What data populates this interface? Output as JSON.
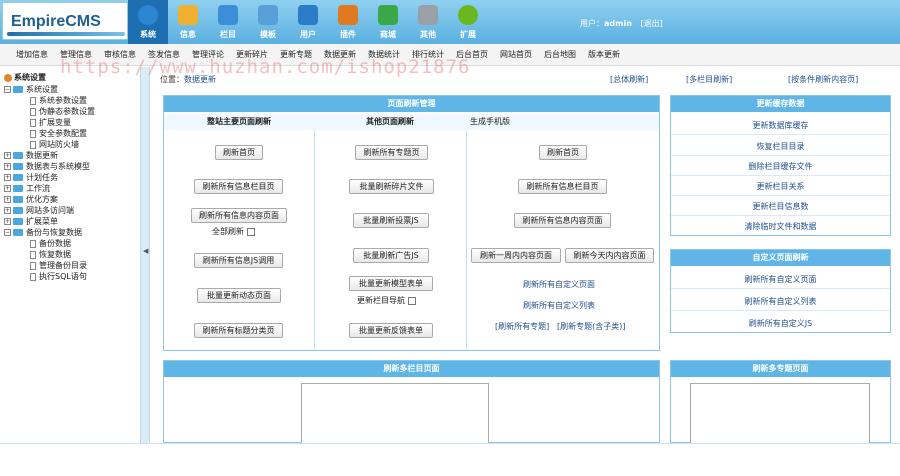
{
  "header": {
    "logo": "EmpireCMS",
    "user_prefix": "用户：",
    "username": "admin",
    "logout": "[退出]",
    "nav": [
      {
        "label": "系统",
        "icon": "globe-icon",
        "color": "#2d86d2"
      },
      {
        "label": "信息",
        "icon": "pencil-note-icon",
        "color": "#f0b030"
      },
      {
        "label": "栏目",
        "icon": "folder-icon",
        "color": "#3a8fd8"
      },
      {
        "label": "模板",
        "icon": "window-icon",
        "color": "#5aa0d8"
      },
      {
        "label": "用户",
        "icon": "user-icon",
        "color": "#2a7cc8"
      },
      {
        "label": "插件",
        "icon": "tools-icon",
        "color": "#e07a20"
      },
      {
        "label": "商城",
        "icon": "shop-icon",
        "color": "#38a848"
      },
      {
        "label": "其他",
        "icon": "gear-icon",
        "color": "#9aa0a8"
      },
      {
        "label": "扩展",
        "icon": "plus-circle-icon",
        "color": "#6ab820"
      }
    ]
  },
  "subnav": [
    "增加信息",
    "管理信息",
    "审核信息",
    "签发信息",
    "管理评论",
    "更新碎片",
    "更新专题",
    "数据更新",
    "数据统计",
    "排行统计",
    "后台首页",
    "网站首页",
    "后台地图",
    "版本更新"
  ],
  "watermark": "https://www.huzhan.com/ishop21876",
  "tree": {
    "title": "系统设置",
    "items": [
      {
        "label": "系统设置",
        "level": 0,
        "expanded": true
      },
      {
        "label": "系统参数设置",
        "level": 1
      },
      {
        "label": "伪静态参数设置",
        "level": 1
      },
      {
        "label": "扩展变量",
        "level": 1
      },
      {
        "label": "安全参数配置",
        "level": 1
      },
      {
        "label": "网站防火墙",
        "level": 1
      },
      {
        "label": "数据更新",
        "level": 0
      },
      {
        "label": "数据表与系统模型",
        "level": 0
      },
      {
        "label": "计划任务",
        "level": 0
      },
      {
        "label": "工作流",
        "level": 0
      },
      {
        "label": "优化方案",
        "level": 0
      },
      {
        "label": "网站多访问端",
        "level": 0
      },
      {
        "label": "扩展菜单",
        "level": 0
      },
      {
        "label": "备份与恢复数据",
        "level": 0,
        "expanded": true
      },
      {
        "label": "备份数据",
        "level": 1
      },
      {
        "label": "恢复数据",
        "level": 1
      },
      {
        "label": "管理备份目录",
        "level": 1
      },
      {
        "label": "执行SQL语句",
        "level": 1
      }
    ]
  },
  "main": {
    "position_label": "位置：",
    "position_link": "数据更新",
    "top_links": [
      "[总体刷新]",
      "[多栏目刷新]",
      "[按条件刷新内容页]"
    ],
    "page_refresh": {
      "title": "页面刷新管理",
      "col1": "整站主要页面刷新",
      "col2": "其他页面刷新",
      "col3": "生成手机版",
      "col1_buttons": [
        "刷新首页",
        "刷新所有信息栏目页",
        "刷新所有信息内容页面",
        "刷新所有信息JS调用",
        "批量更新动态页面",
        "刷新所有标题分类页"
      ],
      "col1_check": "全部刷新",
      "col2_buttons": [
        "刷新所有专题页",
        "批量刷新碎片文件",
        "批量刷新投票JS",
        "批量刷新广告JS",
        "批量更新模型表单",
        "批量更新反馈表单"
      ],
      "col2_check": "更新栏目导航",
      "col3_buttons": [
        "刷新首页",
        "刷新所有信息栏目页",
        "刷新所有信息内容页面",
        "刷新一周内内容页面",
        "刷新今天内内容页面"
      ],
      "col3_links": [
        "刷新所有自定义页面",
        "刷新所有自定义列表",
        "[刷新所有专题]",
        "[刷新专题(含子类)]"
      ]
    },
    "cache": {
      "title": "更新缓存数据",
      "links": [
        "更新数据库缓存",
        "恢复栏目目录",
        "删除栏目缓存文件",
        "更新栏目关系",
        "更新栏目信息数",
        "清除临时文件和数据"
      ]
    },
    "custom_refresh": {
      "title": "自定义页面刷新",
      "links": [
        "刷新所有自定义页面",
        "刷新所有自定义列表",
        "刷新所有自定义JS"
      ]
    },
    "multi_column": {
      "title": "刷新多栏目页面"
    },
    "multi_topic": {
      "title": "刷新多专题页面"
    }
  }
}
